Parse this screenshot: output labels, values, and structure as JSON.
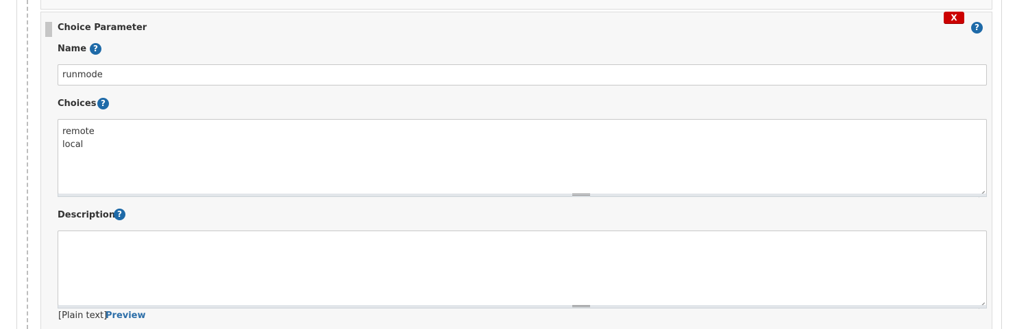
{
  "parameter": {
    "title": "Choice Parameter",
    "delete_label": "X",
    "help_glyph": "?"
  },
  "fields": {
    "name": {
      "label": "Name",
      "value": "runmode",
      "placeholder": ""
    },
    "choices": {
      "label": "Choices",
      "value": "remote\nlocal"
    },
    "description": {
      "label": "Description",
      "value": ""
    }
  },
  "footer": {
    "plain_text": "[Plain text]",
    "preview_label": "Preview"
  },
  "colors": {
    "delete_red": "#cc0000",
    "help_blue": "#1e6aa8",
    "link_blue": "#2c6ea8"
  },
  "icons": {
    "help": "help-icon",
    "drag": "drag-handle-icon",
    "resize": "resize-grip-icon"
  }
}
